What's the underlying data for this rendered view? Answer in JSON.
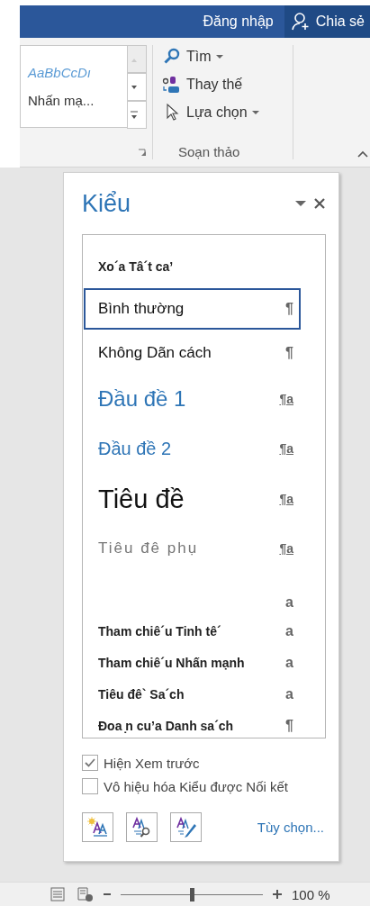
{
  "title_bar": {
    "sign_in": "Đăng nhập",
    "share": "Chia sẻ"
  },
  "ribbon": {
    "gallery": {
      "preview": "AaBbCcDı",
      "name": "Nhấn mạ..."
    },
    "editing_group": {
      "label": "Soạn thảo",
      "commands": [
        {
          "kind": "find",
          "label": "Tìm",
          "dropdown": true
        },
        {
          "kind": "replace",
          "label": "Thay thế",
          "dropdown": false
        },
        {
          "kind": "select",
          "label": "Lựa chọn",
          "dropdown": true
        }
      ]
    }
  },
  "styles_pane": {
    "title": "Kiểu",
    "styles": [
      {
        "kind": "clear",
        "name": "Xo´a Tâ´t caʼ",
        "selected": false
      },
      {
        "kind": "normal",
        "name": "Bình thường",
        "marker": "¶",
        "selected": true
      },
      {
        "kind": "normal",
        "name": "Không Dãn cách",
        "marker": "¶",
        "selected": false
      },
      {
        "kind": "heading1",
        "name": "Đầu đề 1",
        "marker": "¶a",
        "selected": false
      },
      {
        "kind": "heading2",
        "name": "Đầu đề 2",
        "marker": "¶a",
        "selected": false
      },
      {
        "kind": "title",
        "name": "Tiêu đề",
        "marker": "¶a",
        "selected": false
      },
      {
        "kind": "subtitle",
        "name": "Tiêu đê phụ",
        "marker": "¶a",
        "selected": false
      },
      {
        "kind": "blank",
        "marker": "a",
        "selected": false
      },
      {
        "kind": "small",
        "name": "Tham chiê´u Tinh tê´",
        "marker": "a",
        "selected": false
      },
      {
        "kind": "small",
        "name": "Tham chiê´u Nhấn mạnh",
        "marker": "a",
        "selected": false
      },
      {
        "kind": "small",
        "name": "Tiêu đê` Sa´ch",
        "marker": "a",
        "selected": false
      },
      {
        "kind": "small",
        "name": "Đoa ̣n cuʼa Danh sa´ch",
        "marker": "¶",
        "selected": false
      }
    ],
    "options": [
      {
        "label": "Hiện Xem trước",
        "checked": true
      },
      {
        "label": "Vô hiệu hóa Kiểu được Nối kết",
        "checked": false
      }
    ],
    "options_link": "Tùy chọn..."
  },
  "status_bar": {
    "zoom": {
      "level": 0.5,
      "reading": "100 %"
    }
  }
}
